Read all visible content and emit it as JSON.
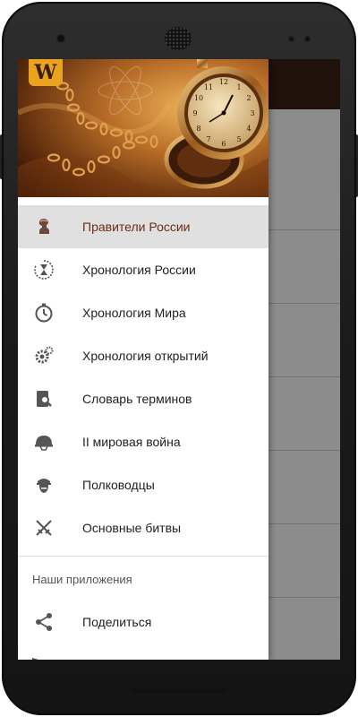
{
  "drawer": {
    "logo_text": "W",
    "menu_items": [
      {
        "label": "Правители России",
        "icon": "ruler-bust-icon",
        "active": true
      },
      {
        "label": "Хронология России",
        "icon": "hourglass-history-icon",
        "active": false
      },
      {
        "label": "Хронология Мира",
        "icon": "stopwatch-icon",
        "active": false
      },
      {
        "label": "Хронология открытий",
        "icon": "gears-icon",
        "active": false
      },
      {
        "label": "Словарь терминов",
        "icon": "book-search-icon",
        "active": false
      },
      {
        "label": "II мировая война",
        "icon": "army-helmet-icon",
        "active": false
      },
      {
        "label": "Полководцы",
        "icon": "military-officer-icon",
        "active": false
      },
      {
        "label": "Основные битвы",
        "icon": "crossed-swords-icon",
        "active": false
      }
    ],
    "section_title": "Наши приложения",
    "share_label": "Поделиться"
  },
  "colors": {
    "active_text": "#6b2c1a",
    "app_toolbar": "#3b1f13",
    "active_row": "#e0e0e0"
  }
}
